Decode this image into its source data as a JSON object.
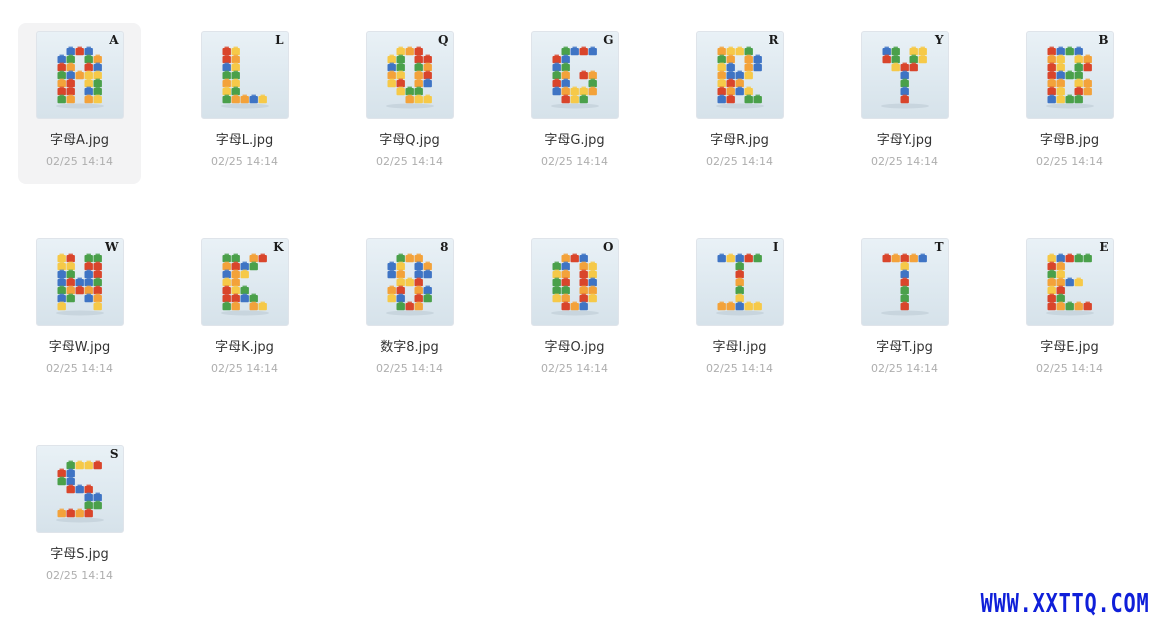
{
  "files": [
    {
      "name": "字母A.jpg",
      "time": "02/25 14:14",
      "corner": "A",
      "selected": true
    },
    {
      "name": "字母L.jpg",
      "time": "02/25 14:14",
      "corner": "L",
      "selected": false
    },
    {
      "name": "字母Q.jpg",
      "time": "02/25 14:14",
      "corner": "Q",
      "selected": false
    },
    {
      "name": "字母G.jpg",
      "time": "02/25 14:14",
      "corner": "G",
      "selected": false
    },
    {
      "name": "字母R.jpg",
      "time": "02/25 14:14",
      "corner": "R",
      "selected": false
    },
    {
      "name": "字母Y.jpg",
      "time": "02/25 14:14",
      "corner": "Y",
      "selected": false
    },
    {
      "name": "字母B.jpg",
      "time": "02/25 14:14",
      "corner": "B",
      "selected": false
    },
    {
      "name": "字母W.jpg",
      "time": "02/25 14:14",
      "corner": "W",
      "selected": false
    },
    {
      "name": "字母K.jpg",
      "time": "02/25 14:14",
      "corner": "K",
      "selected": false
    },
    {
      "name": "数字8.jpg",
      "time": "02/25 14:14",
      "corner": "8",
      "selected": false
    },
    {
      "name": "字母O.jpg",
      "time": "02/25 14:14",
      "corner": "O",
      "selected": false
    },
    {
      "name": "字母I.jpg",
      "time": "02/25 14:14",
      "corner": "I",
      "selected": false
    },
    {
      "name": "字母T.jpg",
      "time": "02/25 14:14",
      "corner": "T",
      "selected": false
    },
    {
      "name": "字母E.jpg",
      "time": "02/25 14:14",
      "corner": "E",
      "selected": false
    },
    {
      "name": "字母S.jpg",
      "time": "02/25 14:14",
      "corner": "S",
      "selected": false
    }
  ],
  "watermark": "WWW.XXTTQ.COM",
  "colors": {
    "brick_red": "#d9452b",
    "brick_orange": "#f3a23a",
    "brick_yellow": "#f6c948",
    "brick_blue": "#3f74c4",
    "brick_green": "#4aa04a",
    "watermark": "#0f1fd9"
  }
}
